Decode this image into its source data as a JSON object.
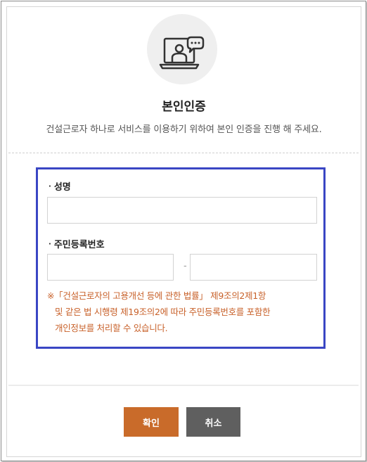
{
  "header": {
    "title": "본인인증",
    "subtitle": "건설근로자 하나로 서비스를 이용하기 위하여 본인 인증을 진행 해 주세요.",
    "icon": "video-call-icon"
  },
  "form": {
    "bullet": "·",
    "name_label": "성명",
    "name_value": "",
    "rrn_label": "주민등록번호",
    "rrn_front_value": "",
    "rrn_back_value": "",
    "rrn_separator": "-",
    "notice_line1": "※「건설근로자의 고용개선 등에 관한 법률」 제9조의2제1항",
    "notice_line2": "및 같은 법 시행령 제19조의2에 따라 주민등록번호를 포함한",
    "notice_line3": "개인정보를 처리할 수 있습니다."
  },
  "buttons": {
    "confirm_label": "확인",
    "cancel_label": "취소"
  },
  "colors": {
    "highlight_border": "#3a46c4",
    "confirm_button": "#c96b2a",
    "cancel_button": "#5f5f5f",
    "notice_text": "#c8612a"
  }
}
